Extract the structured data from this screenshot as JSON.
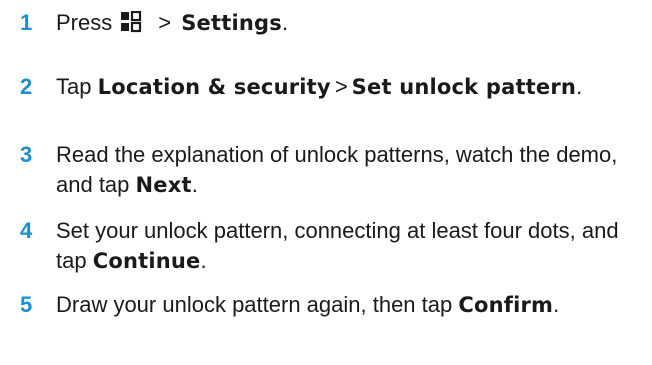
{
  "accent_color": "#1a8fd6",
  "steps": [
    {
      "number": "1",
      "prefix": "Press",
      "icon": "apps-grid-icon",
      "separator": ">",
      "target": "Settings",
      "suffix": "."
    },
    {
      "number": "2",
      "prefix": "Tap",
      "target1": "Location & security",
      "separator": ">",
      "target2": "Set unlock pattern",
      "suffix": "."
    },
    {
      "number": "3",
      "text": "Read the explanation of unlock patterns, watch the demo, and tap",
      "target": "Next",
      "suffix": "."
    },
    {
      "number": "4",
      "text": "Set your unlock pattern, connecting at least four dots, and tap",
      "target": "Continue",
      "suffix": "."
    },
    {
      "number": "5",
      "text": "Draw your unlock pattern again, then tap",
      "target": "Confirm",
      "suffix": "."
    }
  ]
}
